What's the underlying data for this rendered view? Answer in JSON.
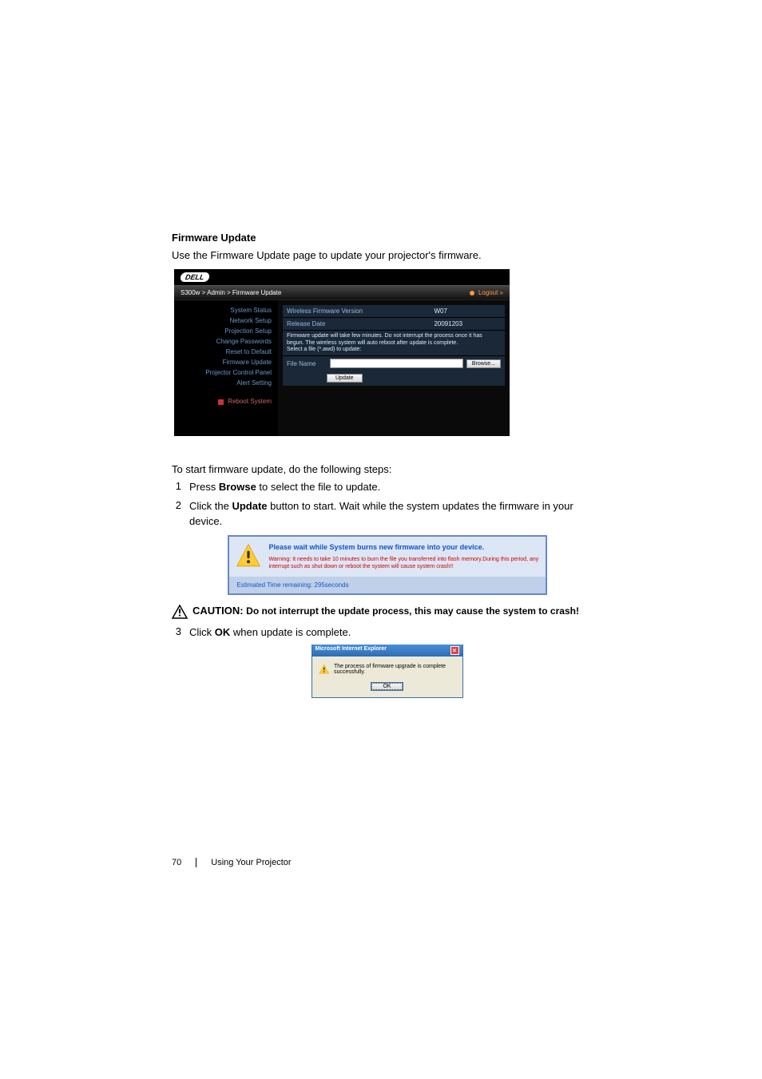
{
  "section_title": "Firmware Update",
  "intro_text": "Use the Firmware Update page to update your projector's firmware.",
  "admin_panel": {
    "logo": "DELL",
    "breadcrumb": "S300w > Admin > Firmware Update",
    "logout": "Logout »",
    "sidebar": {
      "items": [
        "System Status",
        "Network Setup",
        "Projection Setup",
        "Change Passwords",
        "Reset to Default",
        "Firmware Update",
        "Projector Control Panel",
        "Alert Setting"
      ],
      "reboot": "Reboot System"
    },
    "main": {
      "row1_label": "Wireless Firmware Version",
      "row1_value": "W07",
      "row2_label": "Release Date",
      "row2_value": "20091203",
      "warning": "Firmware update will take few minutes. Do not interrupt the process once it has begun. The wireless system will auto reboot after update is complete.",
      "select_file": "Select a file (*.awd) to update:",
      "file_label": "File Name",
      "browse": "Browse...",
      "update": "Update"
    }
  },
  "steps_intro": "To start firmware update, do the following steps:",
  "steps": {
    "s1_num": "1",
    "s1_text_a": "Press ",
    "s1_text_b": "Browse",
    "s1_text_c": " to select the file to update.",
    "s2_num": "2",
    "s2_text_a": "Click the ",
    "s2_text_b": "Update",
    "s2_text_c": " button to start. Wait while the system updates the firmware in your device.",
    "s3_num": "3",
    "s3_text_a": "Click ",
    "s3_text_b": "OK",
    "s3_text_c": " when update is complete."
  },
  "burn_dialog": {
    "title": "Please wait while System burns new firmware into your device.",
    "warning": "Warning: It needs to take 10 minutes to burn the file you transferred into flash memory.During this period, any interrupt such as shut down or reboot the system will cause system crash!!",
    "estimated": "Estimated Time remaining: 295seconds"
  },
  "caution_label": "CAUTION: ",
  "caution_text": "Do not interrupt the update process, this may cause the system to crash!",
  "ok_dialog": {
    "title": "Microsoft Internet Explorer",
    "msg": "The process of firmware upgrade is complete successfully.",
    "ok": "OK"
  },
  "footer": {
    "page_num": "70",
    "section": "Using Your Projector"
  }
}
